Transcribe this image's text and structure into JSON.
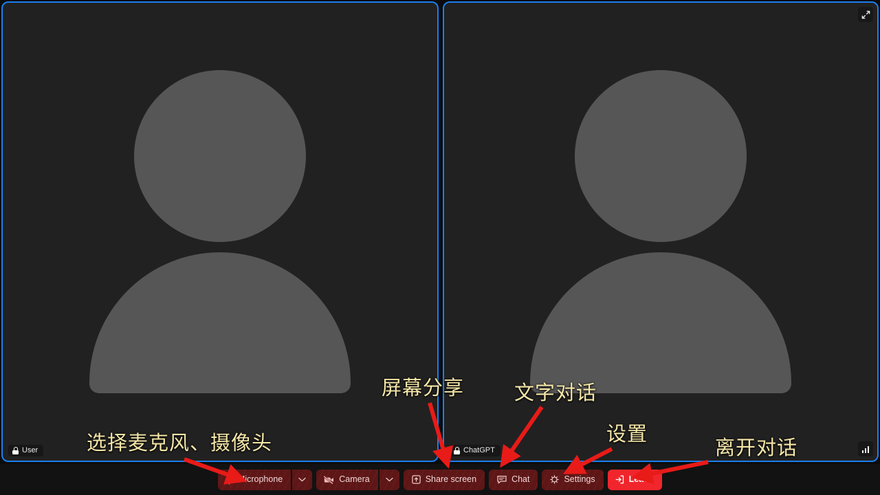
{
  "app": {
    "background_color": "#0c0c0c",
    "tile_border_color": "#1a7ff0",
    "avatar_color": "#565656",
    "toolbar_color": "#121212",
    "annotation_color": "#f5e6a8",
    "arrow_color": "#e81b18",
    "leave_color": "#f0262c"
  },
  "stage": {
    "tiles": [
      {
        "id": "local",
        "name": "User",
        "lock_icon": "lock-icon",
        "avatar_icon": "person-placeholder-icon"
      },
      {
        "id": "remote",
        "name": "ChatGPT",
        "lock_icon": "lock-icon",
        "avatar_icon": "person-placeholder-icon"
      }
    ],
    "expand_icon": "expand-fullscreen-icon",
    "signal_icon": "signal-bars-icon"
  },
  "controls": [
    {
      "id": "microphone",
      "label": "Microphone",
      "icon": "microphone-icon",
      "caret": "chevron-down-icon",
      "state": "muted"
    },
    {
      "id": "camera",
      "label": "Camera",
      "icon": "camera-off-icon",
      "caret": "chevron-down-icon",
      "state": "muted"
    },
    {
      "id": "share-screen",
      "label": "Share screen",
      "icon": "share-screen-icon",
      "caret": null,
      "state": "normal"
    },
    {
      "id": "chat",
      "label": "Chat",
      "icon": "chat-bubble-icon",
      "caret": null,
      "state": "normal"
    },
    {
      "id": "settings",
      "label": "Settings",
      "icon": "gear-icon",
      "caret": null,
      "state": "normal"
    },
    {
      "id": "leave",
      "label": "Leave",
      "icon": "leave-exit-icon",
      "caret": null,
      "state": "danger"
    }
  ],
  "annotations": [
    {
      "id": "select-mic-camera",
      "text": "选择麦克风、摄像头"
    },
    {
      "id": "share-screen",
      "text": "屏幕分享"
    },
    {
      "id": "text-chat",
      "text": "文字对话"
    },
    {
      "id": "settings",
      "text": "设置"
    },
    {
      "id": "leave-call",
      "text": "离开对话"
    }
  ]
}
